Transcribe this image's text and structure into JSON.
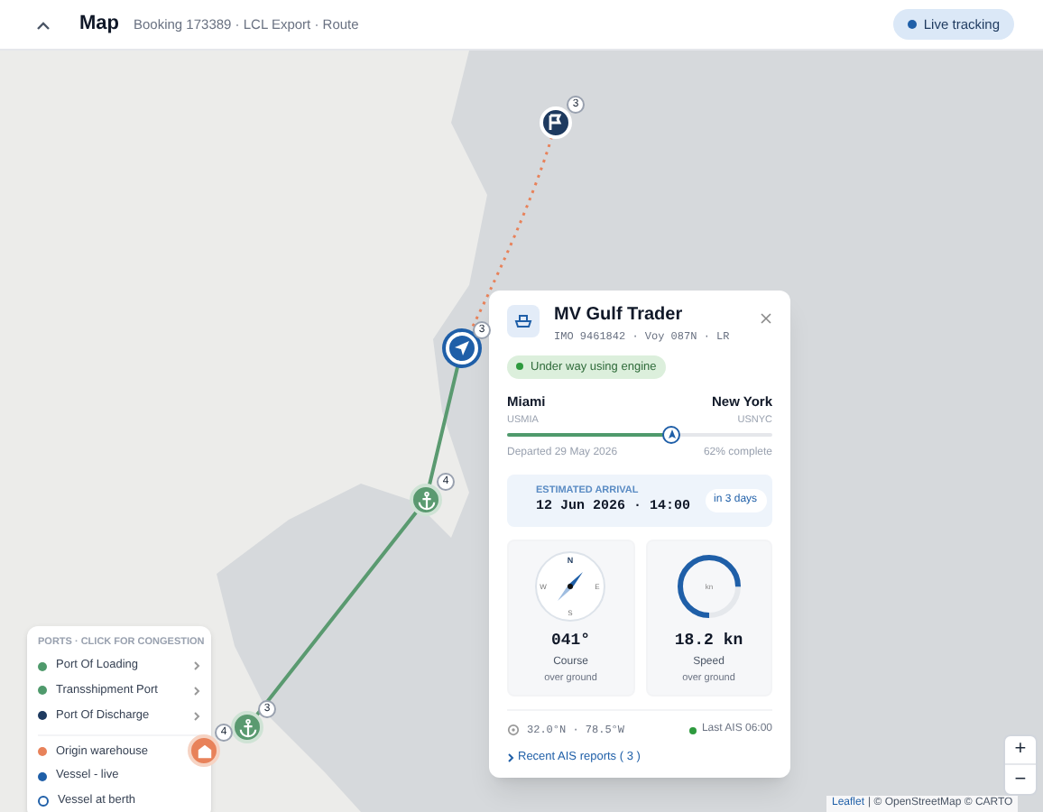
{
  "header": {
    "title": "Map",
    "subtitle": "Booking 173389 · LCL Export · Route",
    "expanded": true,
    "live_badge": "Live tracking"
  },
  "markers": [
    {
      "kind": "flag",
      "count": "3"
    },
    {
      "kind": "vessel",
      "count": "3"
    },
    {
      "kind": "anchor",
      "count": "4"
    },
    {
      "kind": "anchor",
      "count": "3"
    },
    {
      "kind": "warehouse",
      "count": "4"
    }
  ],
  "popup": {
    "title": "MV Gulf Trader",
    "meta": "IMO 9461842 · Voy 087N · LR",
    "status": "Under way using engine",
    "origin": {
      "city": "Miami",
      "code": "USMIA"
    },
    "destination": {
      "city": "New York",
      "code": "USNYC"
    },
    "level": 0.62,
    "departed": "Departed 29 May 2026",
    "complete": "62% complete",
    "eta_label": "ESTIMATED ARRIVAL",
    "eta": "12 Jun 2026 · 14:00",
    "eta_badge": "in 3 days",
    "course": {
      "value": "041°",
      "label": "Course",
      "sub": "over ground",
      "n": "N",
      "e": "E",
      "s": "S",
      "w": "W"
    },
    "speed": {
      "value": "18.2 kn",
      "label": "Speed",
      "sub": "over ground",
      "unit": "kn",
      "level": 0.75
    },
    "position": "32.0°N · 78.5°W",
    "last_ais": "Last AIS 06:00",
    "reports_link": "Recent AIS reports ( 3 )"
  },
  "legend": {
    "title": "PORTS · CLICK FOR CONGESTION",
    "ports": [
      {
        "label": "Port Of Loading",
        "color": "#4f9a6c"
      },
      {
        "label": "Transshipment Port",
        "color": "#4f9a6c"
      },
      {
        "label": "Port Of Discharge",
        "color": "#1e3a5f"
      }
    ],
    "markers": [
      {
        "label": "Origin warehouse",
        "kind": "dot",
        "color": "#e8825a"
      },
      {
        "label": "Vessel - live",
        "kind": "dot",
        "color": "#1f5fa8"
      },
      {
        "label": "Vessel at berth",
        "kind": "ring",
        "color": "#1f5fa8"
      }
    ]
  },
  "zoom": {
    "in": "+",
    "out": "−"
  },
  "attribution": {
    "link": "Leaflet",
    "text": "| © OpenStreetMap © CARTO"
  }
}
